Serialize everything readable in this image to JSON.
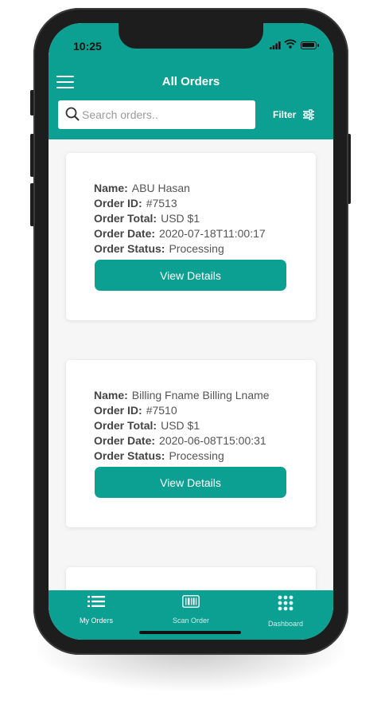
{
  "status_bar": {
    "time": "10:25"
  },
  "header": {
    "title": "All Orders"
  },
  "search": {
    "placeholder": "Search orders.."
  },
  "filter": {
    "label": "Filter"
  },
  "field_labels": {
    "name": "Name:",
    "order_id": "Order ID:",
    "order_total": "Order Total:",
    "order_date": "Order Date:",
    "order_status": "Order Status:"
  },
  "orders": [
    {
      "name": "ABU Hasan",
      "order_id": "#7513",
      "order_total": "USD $1",
      "order_date": "2020-07-18T11:00:17",
      "order_status": "Processing",
      "button": "View Details"
    },
    {
      "name": "Billing Fname Billing Lname",
      "order_id": "#7510",
      "order_total": "USD $1",
      "order_date": "2020-06-08T15:00:31",
      "order_status": "Processing",
      "button": "View Details"
    }
  ],
  "tabs": [
    {
      "label": "My Orders",
      "icon": "list-icon",
      "active": true
    },
    {
      "label": "Scan Order",
      "icon": "barcode-icon",
      "active": false
    },
    {
      "label": "Dashboard",
      "icon": "grid-icon",
      "active": false
    }
  ],
  "colors": {
    "accent": "#0ba091",
    "card_bg": "#ffffff",
    "list_bg": "#f6f6f6"
  }
}
